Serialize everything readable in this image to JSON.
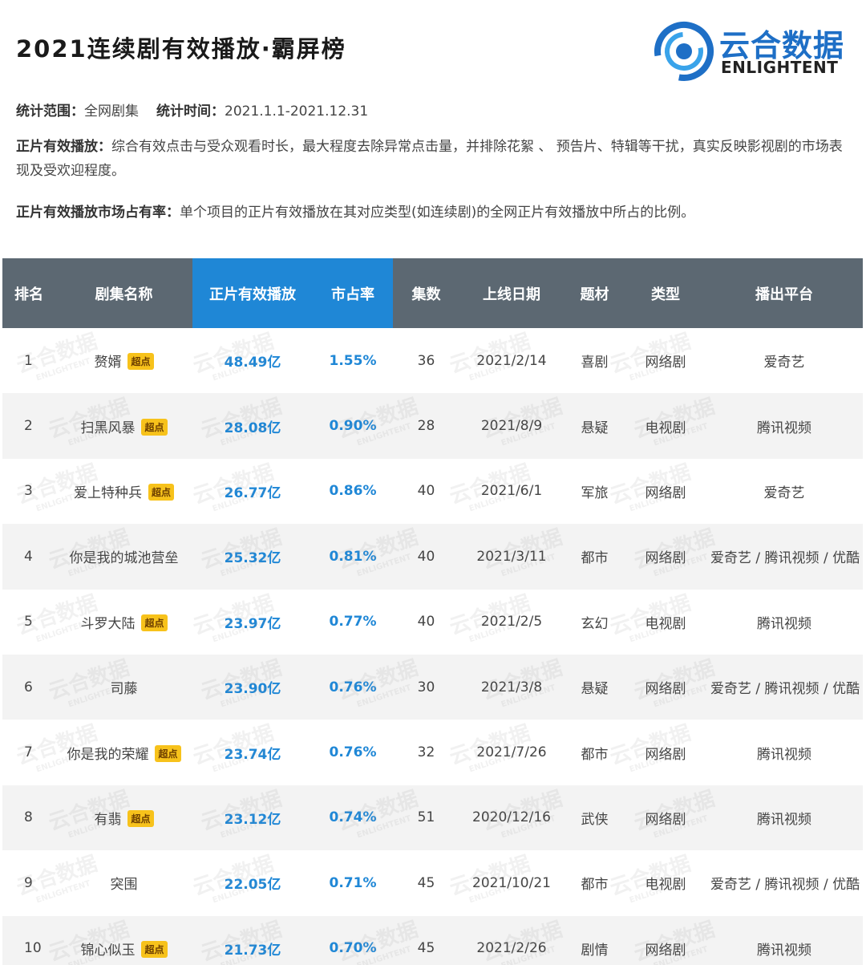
{
  "header": {
    "title": "2021连续剧有效播放·霸屏榜",
    "logo_cn": "云合数据",
    "logo_en": "ENLIGHTENT"
  },
  "description": {
    "scope_label": "统计范围：",
    "scope_value": "全网剧集",
    "time_label": "统计时间：",
    "time_value": "2021.1.1-2021.12.31",
    "play_label": "正片有效播放：",
    "play_text": "综合有效点击与受众观看时长，最大程度去除异常点击量，并排除花絮 、 预告片、特辑等干扰，真实反映影视剧的市场表现及受欢迎程度。",
    "share_label": "正片有效播放市场占有率：",
    "share_text": "单个项目的正片有效播放在其对应类型(如连续剧)的全网正片有效播放中所占的比例。"
  },
  "table": {
    "headers": [
      "排名",
      "剧集名称",
      "正片有效播放",
      "市占率",
      "集数",
      "上线日期",
      "题材",
      "类型",
      "播出平台"
    ],
    "rows": [
      {
        "rank": "1",
        "name": "赘婿",
        "badge": "超点",
        "plays": "48.49亿",
        "share": "1.55%",
        "episodes": "36",
        "date": "2021/2/14",
        "genre": "喜剧",
        "type": "网络剧",
        "platform": "爱奇艺"
      },
      {
        "rank": "2",
        "name": "扫黑风暴",
        "badge": "超点",
        "plays": "28.08亿",
        "share": "0.90%",
        "episodes": "28",
        "date": "2021/8/9",
        "genre": "悬疑",
        "type": "电视剧",
        "platform": "腾讯视频"
      },
      {
        "rank": "3",
        "name": "爱上特种兵",
        "badge": "超点",
        "plays": "26.77亿",
        "share": "0.86%",
        "episodes": "40",
        "date": "2021/6/1",
        "genre": "军旅",
        "type": "网络剧",
        "platform": "爱奇艺"
      },
      {
        "rank": "4",
        "name": "你是我的城池营垒",
        "badge": "",
        "plays": "25.32亿",
        "share": "0.81%",
        "episodes": "40",
        "date": "2021/3/11",
        "genre": "都市",
        "type": "网络剧",
        "platform": "爱奇艺 / 腾讯视频 / 优酷"
      },
      {
        "rank": "5",
        "name": "斗罗大陆",
        "badge": "超点",
        "plays": "23.97亿",
        "share": "0.77%",
        "episodes": "40",
        "date": "2021/2/5",
        "genre": "玄幻",
        "type": "电视剧",
        "platform": "腾讯视频"
      },
      {
        "rank": "6",
        "name": "司藤",
        "badge": "",
        "plays": "23.90亿",
        "share": "0.76%",
        "episodes": "30",
        "date": "2021/3/8",
        "genre": "悬疑",
        "type": "网络剧",
        "platform": "爱奇艺 / 腾讯视频 / 优酷"
      },
      {
        "rank": "7",
        "name": "你是我的荣耀",
        "badge": "超点",
        "plays": "23.74亿",
        "share": "0.76%",
        "episodes": "32",
        "date": "2021/7/26",
        "genre": "都市",
        "type": "网络剧",
        "platform": "腾讯视频"
      },
      {
        "rank": "8",
        "name": "有翡",
        "badge": "超点",
        "plays": "23.12亿",
        "share": "0.74%",
        "episodes": "51",
        "date": "2020/12/16",
        "genre": "武侠",
        "type": "网络剧",
        "platform": "腾讯视频"
      },
      {
        "rank": "9",
        "name": "突围",
        "badge": "",
        "plays": "22.05亿",
        "share": "0.71%",
        "episodes": "45",
        "date": "2021/10/21",
        "genre": "都市",
        "type": "电视剧",
        "platform": "爱奇艺 / 腾讯视频 / 优酷"
      },
      {
        "rank": "10",
        "name": "锦心似玉",
        "badge": "超点",
        "plays": "21.73亿",
        "share": "0.70%",
        "episodes": "45",
        "date": "2021/2/26",
        "genre": "剧情",
        "type": "网络剧",
        "platform": "腾讯视频"
      }
    ]
  },
  "watermark": {
    "cn": "云合数据",
    "en": "ENLIGHTENT"
  },
  "colors": {
    "header_bg": "#5c6872",
    "highlight_header": "#1f87d6",
    "value_text": "#1f87d6",
    "badge_bg": "#f7c21b",
    "stripe": "#f3f3f3"
  }
}
